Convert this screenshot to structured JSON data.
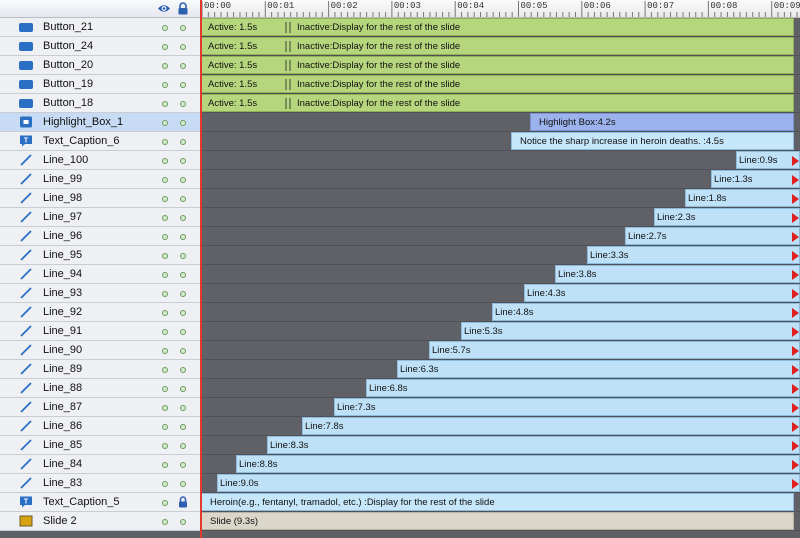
{
  "ruler": {
    "labels": [
      "00:00",
      "00:01",
      "00:02",
      "00:03",
      "00:04",
      "00:05",
      "00:06",
      "00:07",
      "00:08",
      "00:09"
    ]
  },
  "header": {
    "visibility_icon": "eye-icon",
    "lock_icon": "lock-icon"
  },
  "colors": {
    "accent_playhead": "#e23b2e",
    "button_bar": "#b6d67e",
    "line_bar": "#bfe1f7",
    "highlight_bar": "#9cb2ec",
    "slide_bar": "#dad6ca",
    "track_bg": "#5f6166",
    "selected_row": "#c7dcf4"
  },
  "layers": [
    {
      "name": "Button_21",
      "icon": "button-icon",
      "bar": {
        "type": "button",
        "active": "Active: 1.5s",
        "inactive": "Inactive:Display for the rest of the slide"
      }
    },
    {
      "name": "Button_24",
      "icon": "button-icon",
      "bar": {
        "type": "button",
        "active": "Active: 1.5s",
        "inactive": "Inactive:Display for the rest of the slide"
      }
    },
    {
      "name": "Button_20",
      "icon": "button-icon",
      "bar": {
        "type": "button",
        "active": "Active: 1.5s",
        "inactive": "Inactive:Display for the rest of the slide"
      }
    },
    {
      "name": "Button_19",
      "icon": "button-icon",
      "bar": {
        "type": "button",
        "active": "Active: 1.5s",
        "inactive": "Inactive:Display for the rest of the slide"
      }
    },
    {
      "name": "Button_18",
      "icon": "button-icon",
      "bar": {
        "type": "button",
        "active": "Active: 1.5s",
        "inactive": "Inactive:Display for the rest of the slide"
      }
    },
    {
      "name": "Highlight_Box_1",
      "icon": "highlight-box-icon",
      "selected": true,
      "bar": {
        "type": "hl",
        "start": 5.2,
        "label": "Highlight Box:4.2s"
      }
    },
    {
      "name": "Text_Caption_6",
      "icon": "text-caption-icon",
      "bar": {
        "type": "cap",
        "start": 4.9,
        "label": "Notice the sharp increase in heroin deaths. :4.5s"
      }
    },
    {
      "name": "Line_100",
      "icon": "line-icon",
      "bar": {
        "type": "line",
        "start": 8.45,
        "label": "Line:0.9s"
      }
    },
    {
      "name": "Line_99",
      "icon": "line-icon",
      "bar": {
        "type": "line",
        "start": 8.05,
        "label": "Line:1.3s"
      }
    },
    {
      "name": "Line_98",
      "icon": "line-icon",
      "bar": {
        "type": "line",
        "start": 7.65,
        "label": "Line:1.8s"
      }
    },
    {
      "name": "Line_97",
      "icon": "line-icon",
      "bar": {
        "type": "line",
        "start": 7.15,
        "label": "Line:2.3s"
      }
    },
    {
      "name": "Line_96",
      "icon": "line-icon",
      "bar": {
        "type": "line",
        "start": 6.7,
        "label": "Line:2.7s"
      }
    },
    {
      "name": "Line_95",
      "icon": "line-icon",
      "bar": {
        "type": "line",
        "start": 6.1,
        "label": "Line:3.3s"
      }
    },
    {
      "name": "Line_94",
      "icon": "line-icon",
      "bar": {
        "type": "line",
        "start": 5.6,
        "label": "Line:3.8s"
      }
    },
    {
      "name": "Line_93",
      "icon": "line-icon",
      "bar": {
        "type": "line",
        "start": 5.1,
        "label": "Line:4.3s"
      }
    },
    {
      "name": "Line_92",
      "icon": "line-icon",
      "bar": {
        "type": "line",
        "start": 4.6,
        "label": "Line:4.8s"
      }
    },
    {
      "name": "Line_91",
      "icon": "line-icon",
      "bar": {
        "type": "line",
        "start": 4.1,
        "label": "Line:5.3s"
      }
    },
    {
      "name": "Line_90",
      "icon": "line-icon",
      "bar": {
        "type": "line",
        "start": 3.6,
        "label": "Line:5.7s"
      }
    },
    {
      "name": "Line_89",
      "icon": "line-icon",
      "bar": {
        "type": "line",
        "start": 3.1,
        "label": "Line:6.3s"
      }
    },
    {
      "name": "Line_88",
      "icon": "line-icon",
      "bar": {
        "type": "line",
        "start": 2.6,
        "label": "Line:6.8s"
      }
    },
    {
      "name": "Line_87",
      "icon": "line-icon",
      "bar": {
        "type": "line",
        "start": 2.1,
        "label": "Line:7.3s"
      }
    },
    {
      "name": "Line_86",
      "icon": "line-icon",
      "bar": {
        "type": "line",
        "start": 1.6,
        "label": "Line:7.8s"
      }
    },
    {
      "name": "Line_85",
      "icon": "line-icon",
      "bar": {
        "type": "line",
        "start": 1.05,
        "label": "Line:8.3s"
      }
    },
    {
      "name": "Line_84",
      "icon": "line-icon",
      "bar": {
        "type": "line",
        "start": 0.55,
        "label": "Line:8.8s"
      }
    },
    {
      "name": "Line_83",
      "icon": "line-icon",
      "bar": {
        "type": "line",
        "start": 0.25,
        "label": "Line:9.0s"
      }
    },
    {
      "name": "Text_Caption_5",
      "icon": "text-caption-icon",
      "locked": true,
      "bar": {
        "type": "cap",
        "start": 0,
        "label": "Heroin(e.g., fentanyl, tramadol, etc.) :Display for the rest of the slide"
      }
    },
    {
      "name": "Slide 2",
      "icon": "slide-icon",
      "bar": {
        "type": "slide",
        "start": 0,
        "label": "Slide (9.3s)"
      }
    }
  ]
}
